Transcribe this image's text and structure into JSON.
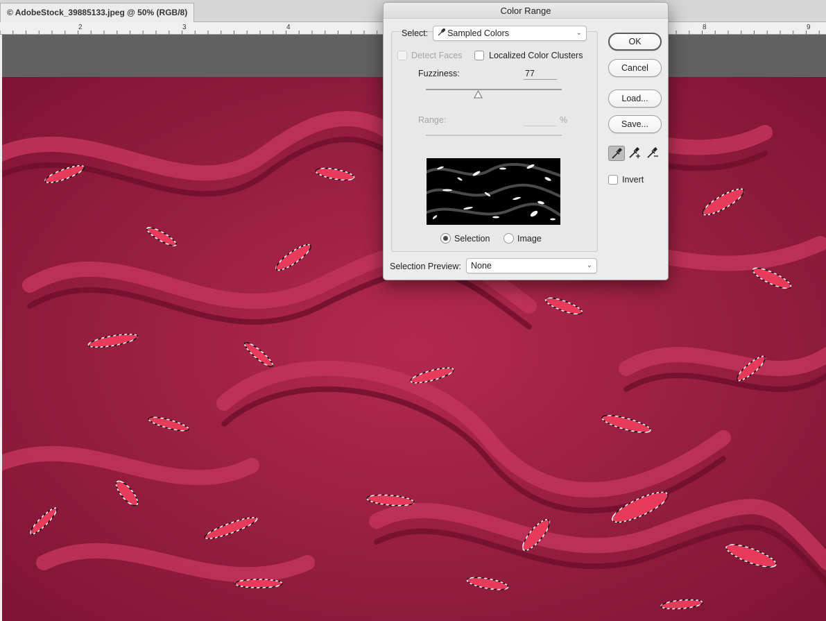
{
  "document": {
    "tab_title": "© AdobeStock_39885133.jpeg @ 50% (RGB/8)"
  },
  "ruler": {
    "labels": [
      "2",
      "3",
      "4",
      "8",
      "9"
    ]
  },
  "dialog": {
    "title": "Color Range",
    "select_label": "Select:",
    "select_value": "Sampled Colors",
    "detect_faces_label": "Detect Faces",
    "detect_faces_checked": false,
    "localized_label": "Localized Color Clusters",
    "localized_checked": false,
    "fuzziness_label": "Fuzziness:",
    "fuzziness_value": "77",
    "fuzziness_fraction": 0.385,
    "range_label": "Range:",
    "range_value": "",
    "range_unit": "%",
    "radio_selection_label": "Selection",
    "radio_image_label": "Image",
    "radio_selected": "selection",
    "selection_preview_label": "Selection Preview:",
    "selection_preview_value": "None",
    "buttons": {
      "ok": "OK",
      "cancel": "Cancel",
      "load": "Load...",
      "save": "Save..."
    },
    "invert_label": "Invert",
    "invert_checked": false
  },
  "colors": {
    "fabric": "#9e2145",
    "highlight": "#e83b5c",
    "dialog_bg": "#ececec"
  },
  "icons": [
    "eyedropper-icon",
    "eyedropper-plus-icon",
    "eyedropper-minus-icon",
    "chevron-down-icon"
  ]
}
